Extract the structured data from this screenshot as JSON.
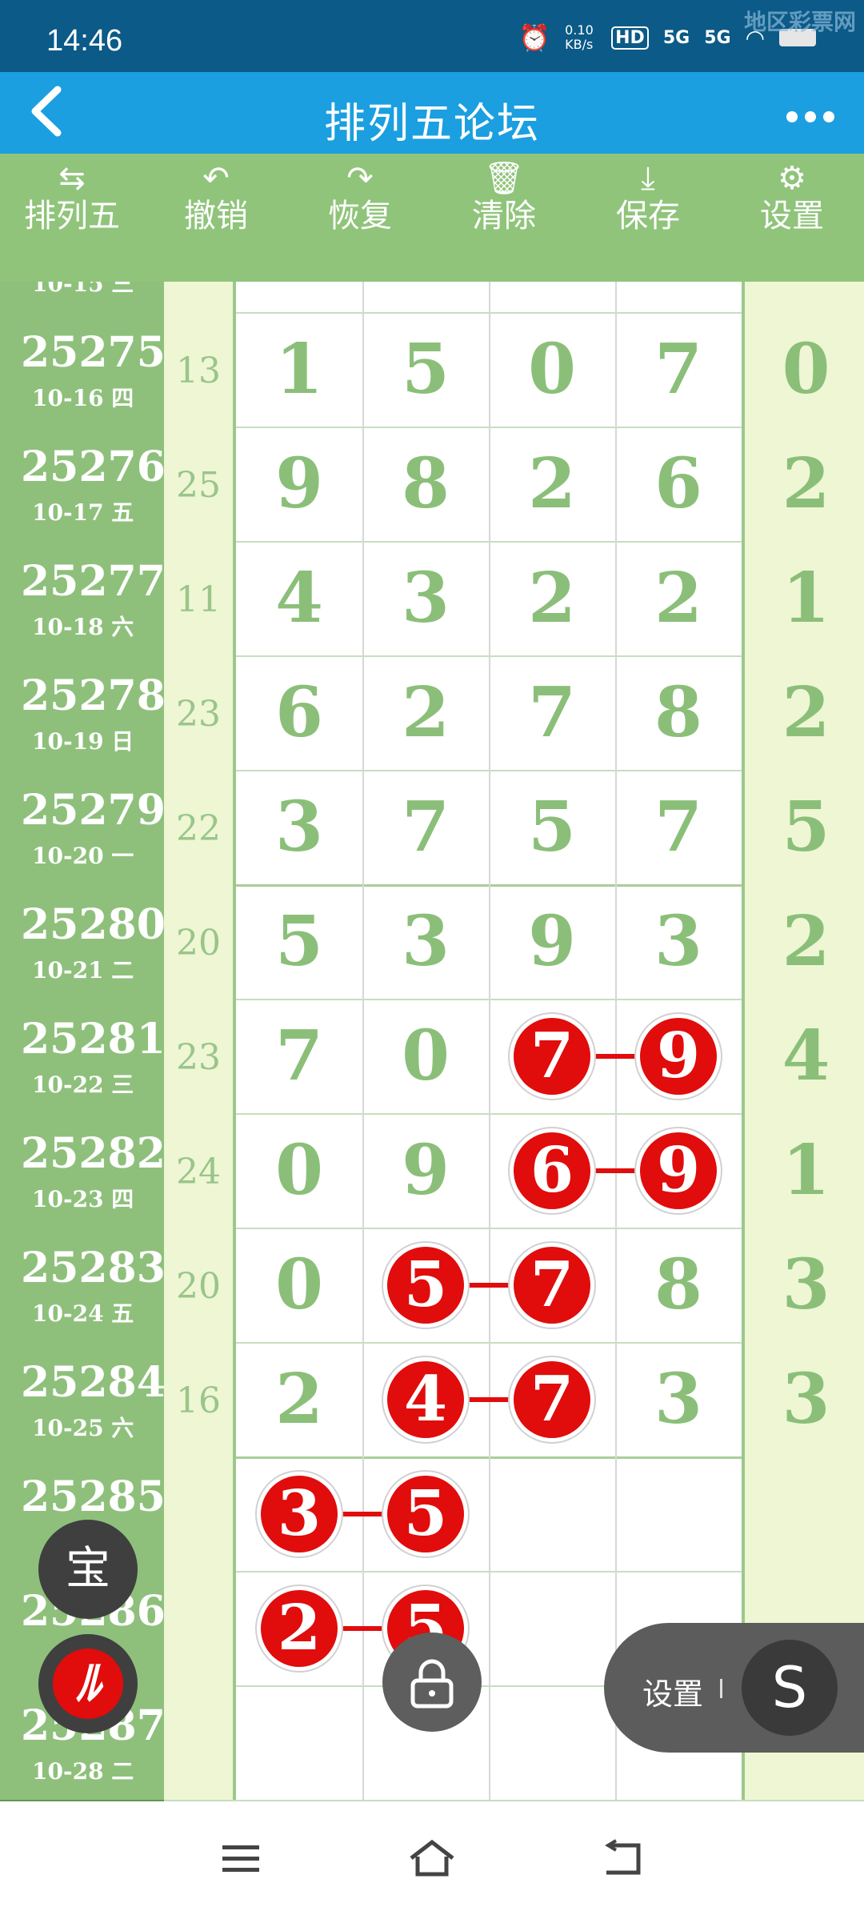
{
  "status_bar": {
    "time": "14:46",
    "net_speed": "0.10 KB/s",
    "hd": "HD",
    "sim1": "5G",
    "sim2": "5G",
    "watermark": "地区彩票网"
  },
  "header": {
    "back_icon": "chevron-left-icon",
    "title": "排列五论坛",
    "more_icon": "more-dots-icon"
  },
  "toolbar": [
    {
      "label": "排列五",
      "icon": "swap-icon"
    },
    {
      "label": "撤销",
      "icon": "undo-icon"
    },
    {
      "label": "恢复",
      "icon": "redo-icon"
    },
    {
      "label": "清除",
      "icon": "trash-icon"
    },
    {
      "label": "保存",
      "icon": "download-icon"
    },
    {
      "label": "设置",
      "icon": "gear-icon"
    }
  ],
  "partial_row": {
    "date": "10-15 三"
  },
  "rows": [
    {
      "issue": "25275",
      "date": "10-16 四",
      "sum": "13",
      "digits": [
        "1",
        "5",
        "0",
        "7",
        "0"
      ]
    },
    {
      "issue": "25276",
      "date": "10-17 五",
      "sum": "25",
      "digits": [
        "9",
        "8",
        "2",
        "6",
        "2"
      ]
    },
    {
      "issue": "25277",
      "date": "10-18 六",
      "sum": "11",
      "digits": [
        "4",
        "3",
        "2",
        "2",
        "1"
      ]
    },
    {
      "issue": "25278",
      "date": "10-19 日",
      "sum": "23",
      "digits": [
        "6",
        "2",
        "7",
        "8",
        "2"
      ]
    },
    {
      "issue": "25279",
      "date": "10-20 一",
      "sum": "22",
      "digits": [
        "3",
        "7",
        "5",
        "7",
        "5"
      ]
    },
    {
      "issue": "25280",
      "date": "10-21 二",
      "sum": "20",
      "digits": [
        "5",
        "3",
        "9",
        "3",
        "2"
      ]
    },
    {
      "issue": "25281",
      "date": "10-22 三",
      "sum": "23",
      "digits": [
        "7",
        "0",
        "7",
        "9",
        "4"
      ]
    },
    {
      "issue": "25282",
      "date": "10-23 四",
      "sum": "24",
      "digits": [
        "0",
        "9",
        "6",
        "9",
        "1"
      ]
    },
    {
      "issue": "25283",
      "date": "10-24 五",
      "sum": "20",
      "digits": [
        "0",
        "5",
        "7",
        "8",
        "3"
      ]
    },
    {
      "issue": "25284",
      "date": "10-25 六",
      "sum": "16",
      "digits": [
        "2",
        "4",
        "7",
        "3",
        "3"
      ]
    },
    {
      "issue": "25285",
      "date": "",
      "sum": "",
      "digits": [
        "3",
        "5",
        "",
        "",
        ""
      ]
    },
    {
      "issue": "25286",
      "date": "",
      "sum": "",
      "digits": [
        "2",
        "5",
        "",
        "",
        ""
      ]
    },
    {
      "issue": "25287",
      "date": "10-28 二",
      "sum": "",
      "digits": [
        "",
        "",
        "",
        "",
        ""
      ]
    }
  ],
  "marks": [
    {
      "row": 6,
      "cols": [
        2,
        3
      ],
      "values": [
        "7",
        "9"
      ]
    },
    {
      "row": 7,
      "cols": [
        2,
        3
      ],
      "values": [
        "6",
        "9"
      ]
    },
    {
      "row": 8,
      "cols": [
        1,
        2
      ],
      "values": [
        "5",
        "7"
      ]
    },
    {
      "row": 9,
      "cols": [
        1,
        2
      ],
      "values": [
        "4",
        "7"
      ]
    },
    {
      "row": 10,
      "cols": [
        0,
        1
      ],
      "values": [
        "3",
        "5"
      ]
    },
    {
      "row": 11,
      "cols": [
        0,
        1
      ],
      "values": [
        "2",
        "5"
      ]
    }
  ],
  "floating": {
    "bao_label": "宝",
    "settings_label": "设置",
    "s_label": "S",
    "lock_icon": "lock-icon",
    "app_icon": "app-logo-icon"
  },
  "nav_bar": {
    "menu_icon": "menu-icon",
    "home_icon": "home-icon",
    "back_icon": "back-icon"
  }
}
